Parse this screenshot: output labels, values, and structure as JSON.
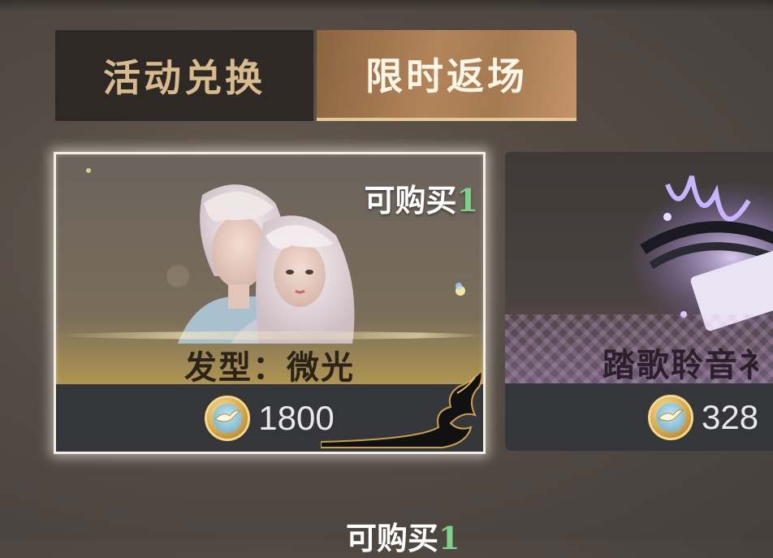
{
  "tabs": [
    {
      "label": "活动兑换",
      "active": false
    },
    {
      "label": "限时返场",
      "active": true
    }
  ],
  "items": [
    {
      "name": "发型：微光",
      "availability_label": "可购买",
      "availability_count": "1",
      "price": "1800",
      "currency_icon": "crane-coin-icon",
      "selected": true
    },
    {
      "name": "踏歌聆音衤",
      "price": "328",
      "currency_icon": "crane-coin-icon",
      "selected": false
    }
  ],
  "next_row": {
    "availability_label": "可购买",
    "availability_count": "1"
  },
  "colors": {
    "tab_active_bg": "#b3845a",
    "tab_inactive_bg": "#2e2925",
    "price_bar_bg": "#34363a",
    "count_green": "#7fd08a"
  }
}
